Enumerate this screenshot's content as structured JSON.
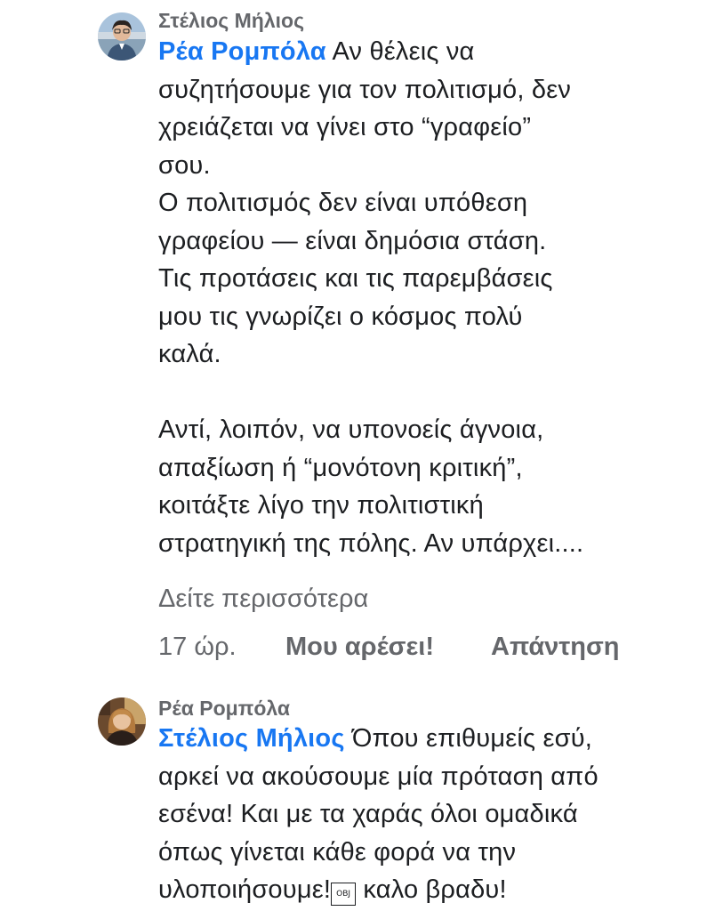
{
  "comments": [
    {
      "author": "Στέλιος Μήλιος",
      "avatar_icon": "person-photo-icon",
      "mention": "Ρέα Ρομπόλα",
      "first_line_rest": " Αν θέλεις να",
      "lines": [
        "συζητήσουμε για τον πολιτισμό, δεν",
        "χρειάζεται να γίνει στο “γραφείο”",
        "σου.",
        "Ο πολιτισμός δεν είναι υπόθεση",
        "γραφείου — είναι δημόσια στάση.",
        "Τις προτάσεις και τις παρεμβάσεις",
        "μου τις γνωρίζει ο κόσμος πολύ",
        "καλά.",
        "",
        "Αντί, λοιπόν, να υπονοείς άγνοια,",
        "απαξίωση ή “μονότονη κριτική”,",
        "κοιτάξτε λίγο την πολιτιστική",
        "στρατηγική της πόλης. Αν υπάρχει...."
      ],
      "see_more": "Δείτε περισσότερα",
      "time": "17 ώρ.",
      "like": "Μου αρέσει!",
      "reply": "Απάντηση"
    },
    {
      "author": "Ρέα Ρομπόλα",
      "avatar_icon": "person-photo-icon",
      "mention": "Στέλιος Μήλιος",
      "first_line_rest": " Όπου επιθυμείς εσύ,",
      "lines": [
        "αρκεί να ακούσουμε μία πρόταση από",
        "εσένα! Και με τα χαράς όλοι ομαδικά",
        "όπως γίνεται κάθε φορά να την"
      ],
      "last_line_start": "υλοποιήσουμε!",
      "obj_glyph": "OBJ",
      "last_line_end": " καλο βραδυ!"
    }
  ]
}
